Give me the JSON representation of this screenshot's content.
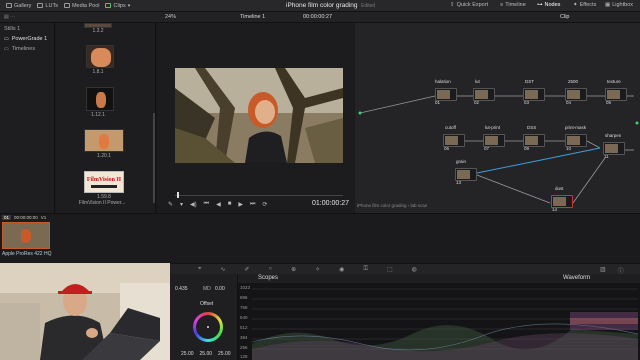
{
  "topbar": {
    "gallery": "Gallery",
    "luts": "LUTs",
    "media_pool": "Media Pool",
    "clips": "Clips",
    "project_title": "iPhone film color grading",
    "edited": "Edited",
    "quick_export": "Quick Export",
    "timeline": "Timeline",
    "nodes": "Nodes",
    "effects": "Effects",
    "lightbox": "Lightbox"
  },
  "bar2": {
    "zoom": "24%",
    "timeline_name": "Timeline 1",
    "timecode": "00:00:00:27",
    "clip_mode": "Clip"
  },
  "gallery": {
    "items": [
      "Stills 1",
      "PowerGrade 1",
      "Timelines"
    ]
  },
  "stills": {
    "labels": [
      "1.3.2",
      "1.8.1",
      "1.12.1",
      "1.20.1",
      "1.59.8"
    ],
    "powergrade_title": "FilmVision II",
    "powergrade_caption": "FilmVision II Power..."
  },
  "viewer": {
    "timecode": "01:00:00:27"
  },
  "nodes": {
    "labels": [
      "halation",
      "lut",
      "DST",
      "2500",
      "texture",
      "cutoff",
      "lut-print",
      "DSS",
      "print-mask",
      "sharpen",
      "grain",
      "dust"
    ],
    "numbers": [
      "01",
      "02",
      "03",
      "04",
      "05",
      "06",
      "07",
      "09",
      "10",
      "11",
      "13",
      "14"
    ],
    "breadcrumb": "iPhone film color grading",
    "breadcrumb_sub": "lab scan"
  },
  "clipstrip": {
    "clip_number": "01",
    "clip_tc": "00:00:00:00",
    "clip_track": "V1",
    "clip_codec": "Apple ProRes 422 HQ"
  },
  "colorpanel": {
    "contrast_val": "0.435",
    "md_label": "MD",
    "md_val": "0.00",
    "offset_label": "Offset",
    "rgb_vals": [
      "25.00",
      "25.00",
      "25.00"
    ]
  },
  "scopes": {
    "title": "Scopes",
    "mode": "Waveform",
    "ticks": [
      "1023",
      "896",
      "768",
      "640",
      "512",
      "384",
      "256",
      "128"
    ]
  },
  "colors": {
    "accent_green": "#3fd16a",
    "connection_blue": "#3aa0e0",
    "panel_bg": "#1a1a1c"
  }
}
